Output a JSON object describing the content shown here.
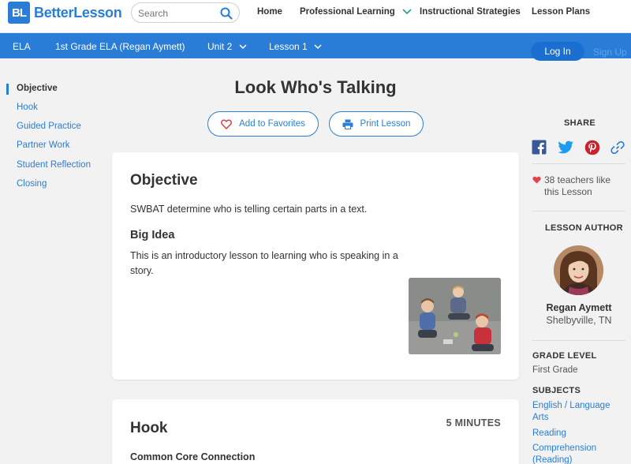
{
  "brand": {
    "logo_mark": "BL",
    "name": "BetterLesson",
    "color": "#2a7dd6"
  },
  "search": {
    "placeholder": "Search",
    "icon": "search-icon"
  },
  "nav": {
    "home": "Home",
    "professional_learning": "Professional Learning",
    "instructional_strategies": "Instructional Strategies",
    "lesson_plans": "Lesson Plans"
  },
  "breadcrumb": {
    "subject": "ELA",
    "course": "1st Grade ELA (Regan Aymett)",
    "unit": "Unit 2",
    "lesson": "Lesson 1"
  },
  "auth": {
    "login": "Log In",
    "signup": "Sign Up"
  },
  "sidebar": {
    "items": [
      {
        "label": "Objective",
        "active": true
      },
      {
        "label": "Hook"
      },
      {
        "label": "Guided Practice"
      },
      {
        "label": "Partner Work"
      },
      {
        "label": "Student Reflection"
      },
      {
        "label": "Closing"
      }
    ]
  },
  "lesson": {
    "title": "Look Who's Talking",
    "add_favorites": "Add to Favorites",
    "print": "Print Lesson"
  },
  "objective_card": {
    "heading": "Objective",
    "text": "SWBAT determine who is telling certain parts in a text.",
    "big_idea_heading": "Big Idea",
    "big_idea_text": "This is an introductory lesson to learning who is speaking in a story."
  },
  "hook_card": {
    "heading": "Hook",
    "minutes": "5 MINUTES",
    "subheading": "Common Core Connection"
  },
  "share": {
    "label": "SHARE",
    "icons": [
      "facebook-icon",
      "twitter-icon",
      "pinterest-icon",
      "link-icon"
    ]
  },
  "likes": {
    "text": "38 teachers like this Lesson"
  },
  "author": {
    "label": "LESSON AUTHOR",
    "name": "Regan Aymett",
    "location": "Shelbyville, TN"
  },
  "grade": {
    "label": "GRADE LEVEL",
    "value": "First Grade"
  },
  "subjects": {
    "label": "SUBJECTS",
    "items": [
      "English / Language Arts",
      "Reading",
      "Comprehension (Reading)"
    ]
  }
}
